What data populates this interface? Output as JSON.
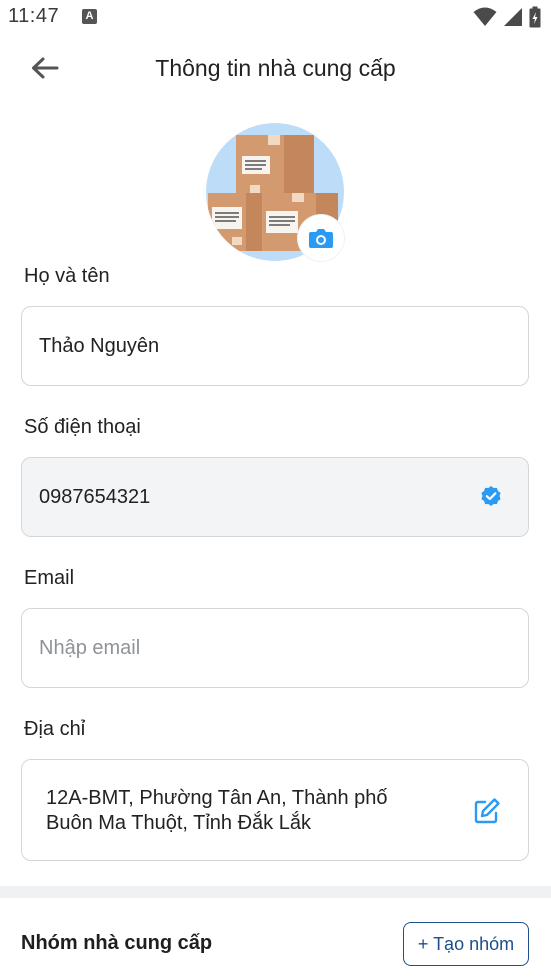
{
  "status_bar": {
    "time": "11:47",
    "notification_badge": "A"
  },
  "header": {
    "title": "Thông tin nhà cung cấp"
  },
  "form": {
    "full_name": {
      "label": "Họ và tên",
      "value": "Thảo Nguyên"
    },
    "phone": {
      "label": "Số điện thoại",
      "value": "0987654321",
      "verified": true
    },
    "email": {
      "label": "Email",
      "value": "",
      "placeholder": "Nhập email"
    },
    "address": {
      "label": "Địa chỉ",
      "value": "12A-BMT,  Phường Tân An,  Thành phố Buôn Ma Thuột,  Tỉnh Đắk Lắk"
    }
  },
  "supplier_group": {
    "title": "Nhóm nhà cung cấp",
    "create_button_label": "+ Tạo nhóm"
  },
  "colors": {
    "accent": "#2b9af3",
    "primary_dark": "#1b4f8e",
    "avatar_bg": "#bcdcf7",
    "box_brown": "#d39a70"
  },
  "icons": {
    "back": "arrow-left-icon",
    "camera": "camera-icon",
    "verified": "check-circle-icon",
    "edit": "edit-icon",
    "wifi": "wifi-icon",
    "signal": "signal-icon",
    "battery": "battery-icon"
  }
}
